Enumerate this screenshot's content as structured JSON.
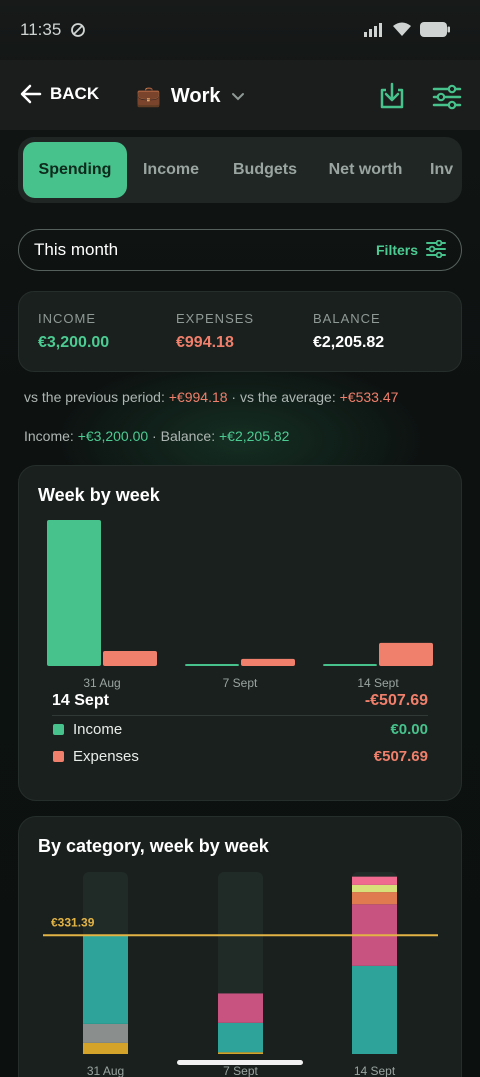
{
  "status_bar": {
    "time": "11:35"
  },
  "header": {
    "back_label": "BACK",
    "title": "Work",
    "title_emoji": "💼"
  },
  "tabs": [
    {
      "label": "Spending",
      "active": true
    },
    {
      "label": "Income"
    },
    {
      "label": "Budgets"
    },
    {
      "label": "Net worth"
    },
    {
      "label": "Inv"
    }
  ],
  "period": {
    "label": "This month",
    "filters_label": "Filters"
  },
  "summary": {
    "income_label": "INCOME",
    "income_value": "€3,200.00",
    "expenses_label": "EXPENSES",
    "expenses_value": "€994.18",
    "balance_label": "BALANCE",
    "balance_value": "€2,205.82"
  },
  "comparison": {
    "prev_label": "vs the previous period: ",
    "prev_value": "+€994.18",
    "avg_label": " · vs the average: ",
    "avg_value": "+€533.47",
    "income_label": "Income: ",
    "income_value": "+€3,200.00",
    "balance_label": " · Balance: ",
    "balance_value": "+€2,205.82"
  },
  "week_chart": {
    "title": "Week by week",
    "selected_week": "14 Sept",
    "selected_total": "-€507.69",
    "legend": [
      {
        "name": "Income",
        "value": "€0.00",
        "color": "#47c28c"
      },
      {
        "name": "Expenses",
        "value": "€507.69",
        "color": "#f07f6b"
      }
    ]
  },
  "category_chart": {
    "title": "By category, week by week",
    "average_label": "€331.39"
  },
  "chart_data": [
    {
      "type": "bar",
      "title": "Week by week",
      "categories": [
        "31 Aug",
        "7 Sept",
        "14 Sept"
      ],
      "series": [
        {
          "name": "Income",
          "color": "#47c28c",
          "values": [
            3200,
            0,
            0
          ]
        },
        {
          "name": "Expenses",
          "color": "#f07f6b",
          "values": [
            330,
            156,
            508
          ]
        }
      ],
      "ylim": [
        0,
        3200
      ]
    },
    {
      "type": "bar",
      "stacked": true,
      "title": "By category, week by week",
      "categories": [
        "31 Aug",
        "7 Sept",
        "14 Sept"
      ],
      "average": 331.39,
      "ylim": [
        0,
        508
      ],
      "series": [
        {
          "color": "#d4a32a",
          "values": [
            31,
            5,
            0
          ]
        },
        {
          "color": "#8a8f8d",
          "values": [
            53,
            0,
            0
          ]
        },
        {
          "color": "#2da39a",
          "values": [
            246,
            82,
            246
          ]
        },
        {
          "color": "#c95380",
          "values": [
            0,
            82,
            172
          ]
        },
        {
          "color": "#e07a4f",
          "values": [
            0,
            0,
            34
          ]
        },
        {
          "color": "#d8e07a",
          "values": [
            0,
            0,
            20
          ]
        },
        {
          "color": "#f06a90",
          "values": [
            0,
            0,
            23
          ]
        }
      ]
    }
  ]
}
